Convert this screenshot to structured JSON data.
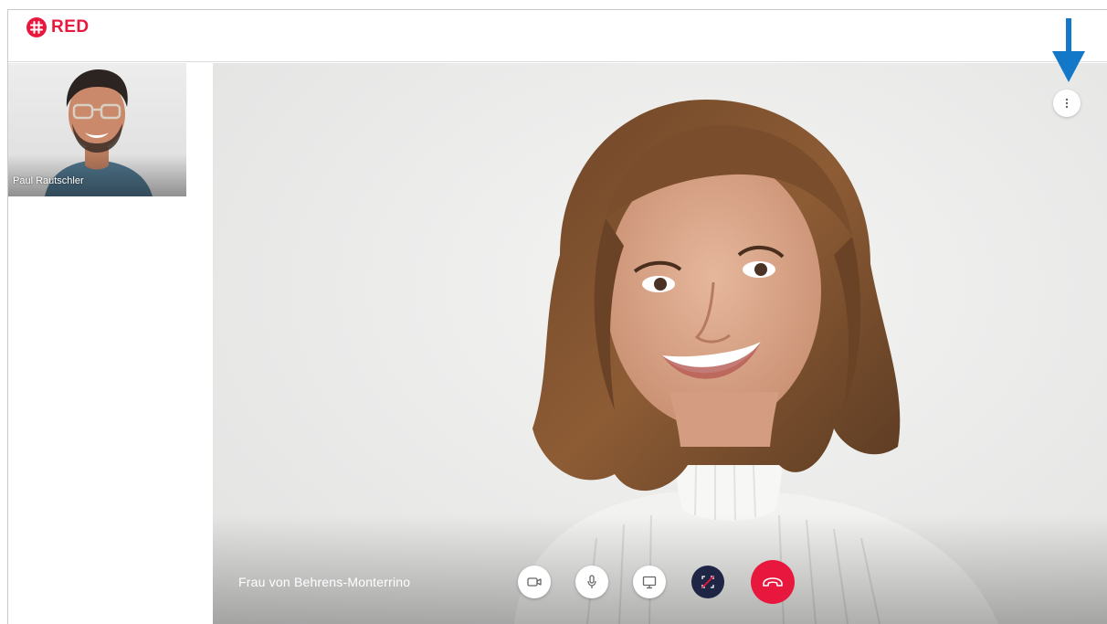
{
  "app": {
    "brand_name": "RED",
    "brand_color": "#e8173e"
  },
  "sidebar": {
    "participant_name": "Paul Rautschler"
  },
  "stage": {
    "caller_name": "Frau von Behrens-Monterrino"
  },
  "controls": {
    "camera": {
      "icon": "camera-icon"
    },
    "microphone": {
      "icon": "microphone-icon"
    },
    "screen_share": {
      "icon": "screen-share-icon"
    },
    "fullscreen_off": {
      "icon": "fullscreen-off-icon",
      "color": "#1f2544"
    },
    "hangup": {
      "icon": "phone-hangup-icon",
      "color": "#e8173e"
    },
    "more": {
      "icon": "more-vertical-icon"
    }
  },
  "annotation": {
    "arrow_color": "#1478c8"
  }
}
